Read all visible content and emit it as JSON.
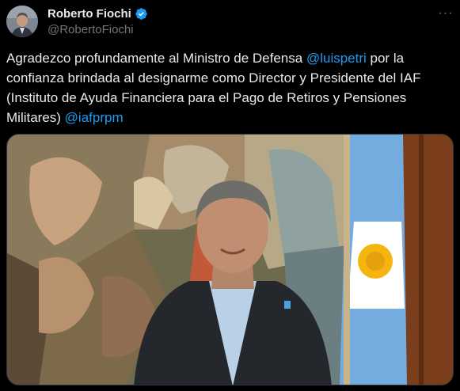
{
  "author": {
    "display_name": "Roberto Fiochi",
    "handle": "@RobertoFiochi",
    "verified_icon": "verified-badge-icon",
    "verified_color": "#1d9bf0"
  },
  "menu": {
    "more_label": "···"
  },
  "tweet": {
    "text_1": "Agradezco profundamente al Ministro de Defensa ",
    "mention_1": "@luispetri",
    "text_2": " por la confianza brindada al designarme como Director y Presidente del IAF (Instituto de Ayuda Financiera para el Pago de Retiros y Pensiones Militares) ",
    "mention_2": "@iafprpm"
  },
  "colors": {
    "background": "#000000",
    "text": "#e7e9ea",
    "secondary": "#71767b",
    "link": "#1d9bf0"
  }
}
